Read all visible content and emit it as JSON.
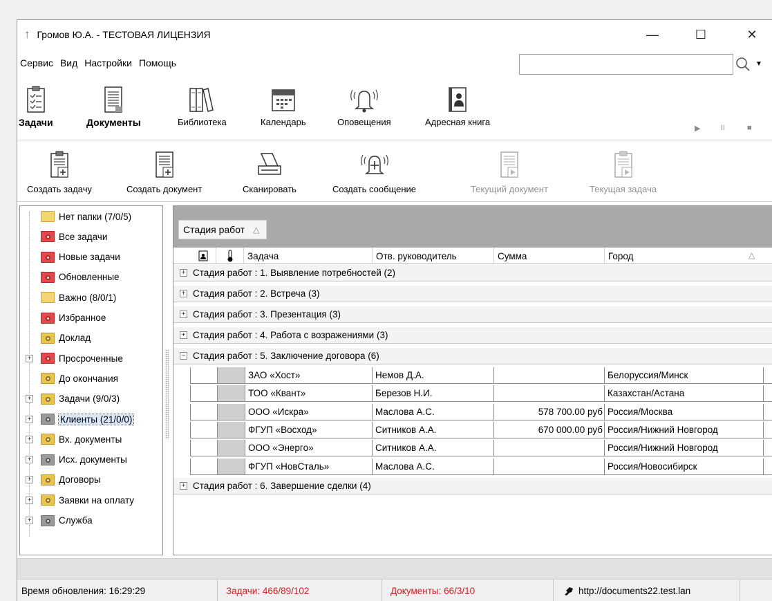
{
  "window": {
    "title": "Громов Ю.А. - ТЕСТОВАЯ ЛИЦЕНЗИЯ",
    "minimize": "—",
    "maximize": "☐",
    "close": "✕"
  },
  "menu": [
    "Сервис",
    "Вид",
    "Настройки",
    "Помощь"
  ],
  "search": {
    "value": "",
    "placeholder": ""
  },
  "toolbar_main": [
    {
      "label": "Задачи",
      "icon": "tasks-icon"
    },
    {
      "label": "Документы",
      "icon": "documents-icon"
    },
    {
      "label": "Библиотека",
      "icon": "library-icon"
    },
    {
      "label": "Календарь",
      "icon": "calendar-icon"
    },
    {
      "label": "Оповещения",
      "icon": "bell-icon"
    },
    {
      "label": "Адресная книга",
      "icon": "address-book-icon"
    }
  ],
  "media": {
    "play": "▶",
    "pause": "II",
    "stop": "■"
  },
  "toolbar_actions": [
    {
      "label": "Создать задачу"
    },
    {
      "label": "Создать документ"
    },
    {
      "label": "Сканировать"
    },
    {
      "label": "Создать сообщение"
    },
    {
      "label": "Текущий документ"
    },
    {
      "label": "Текущая задача"
    }
  ],
  "tree": [
    {
      "label": "Нет папки (7/0/5)",
      "color": "plain",
      "expand": false
    },
    {
      "label": "Все задачи",
      "color": "red",
      "expand": false
    },
    {
      "label": "Новые задачи",
      "color": "red",
      "expand": false
    },
    {
      "label": "Обновленные",
      "color": "red",
      "expand": false
    },
    {
      "label": "Важно (8/0/1)",
      "color": "plain",
      "expand": false
    },
    {
      "label": "Избранное",
      "color": "red",
      "expand": false
    },
    {
      "label": "Доклад",
      "color": "yel",
      "expand": false
    },
    {
      "label": "Просроченные",
      "color": "red",
      "expand": true
    },
    {
      "label": "До окончания",
      "color": "yel",
      "expand": false
    },
    {
      "label": "Задачи (9/0/3)",
      "color": "yel",
      "expand": true
    },
    {
      "label": "Клиенты (21/0/0)",
      "color": "gray",
      "expand": true,
      "selected": true
    },
    {
      "label": "Вх. документы",
      "color": "yel",
      "expand": true
    },
    {
      "label": "Исх. документы",
      "color": "gray",
      "expand": true
    },
    {
      "label": "Договоры",
      "color": "yel",
      "expand": true
    },
    {
      "label": "Заявки на оплату",
      "color": "yel",
      "expand": true
    },
    {
      "label": "Служба",
      "color": "gray",
      "expand": true
    }
  ],
  "grid": {
    "group_by": "Стадия работ",
    "group_sort": "△",
    "columns": [
      "Задача",
      "Отв. руководитель",
      "Сумма",
      "Город"
    ],
    "city_sort": "△",
    "groups": [
      {
        "label": "Стадия работ : 1. Выявление потребностей (2)",
        "pm": "+"
      },
      {
        "label": "Стадия работ : 2. Встреча (3)",
        "pm": "+"
      },
      {
        "label": "Стадия работ : 3. Презентация (3)",
        "pm": "+"
      },
      {
        "label": "Стадия работ : 4. Работа с возражениями (3)",
        "pm": "+"
      },
      {
        "label": "Стадия работ : 5. Заключение договора (6)",
        "pm": "−"
      }
    ],
    "rows": [
      {
        "task": "ЗАО «Хост»",
        "manager": "Немов Д.А.",
        "sum": "",
        "city": "Белоруссия/Минск"
      },
      {
        "task": "ТОО «Квант»",
        "manager": "Березов Н.И.",
        "sum": "",
        "city": "Казахстан/Астана"
      },
      {
        "task": "ООО «Искра»",
        "manager": "Маслова А.С.",
        "sum": "578 700.00 руб",
        "city": "Россия/Москва"
      },
      {
        "task": "ФГУП «Восход»",
        "manager": "Ситников А.А.",
        "sum": "670 000.00 руб",
        "city": "Россия/Нижний Новгород"
      },
      {
        "task": "ООО «Энерго»",
        "manager": "Ситников А.А.",
        "sum": "",
        "city": "Россия/Нижний Новгород"
      },
      {
        "task": "ФГУП «НовСталь»",
        "manager": "Маслова А.С.",
        "sum": "",
        "city": "Россия/Новосибирск"
      }
    ],
    "last_group": {
      "label": "Стадия работ : 6. Завершение сделки (4)",
      "pm": "+"
    }
  },
  "status": {
    "updated": "Время обновления: 16:29:29",
    "tasks": "Задачи: 466/89/102",
    "docs": "Документы: 66/3/10",
    "url": "http://documents22.test.lan"
  },
  "colors": {
    "accent_red": "#d42121",
    "logo": "#e03a1e"
  }
}
